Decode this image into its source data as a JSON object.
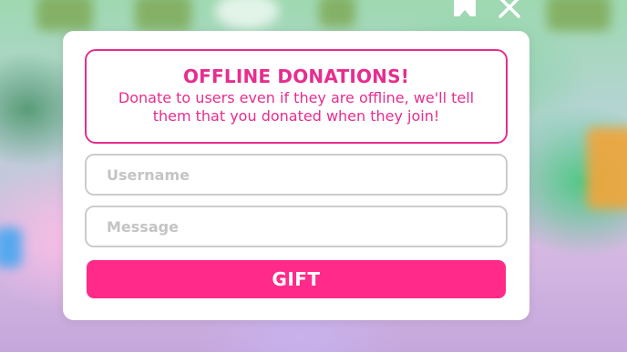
{
  "modal": {
    "title": "OFFLINE DONATIONS!",
    "description": "Donate to users even if they are offline, we'll tell them that you donated when they join!",
    "username_placeholder": "Username",
    "message_placeholder": "Message",
    "gift_label": "GIFT"
  },
  "hud": {
    "icons": [
      "tag-icon",
      "close-icon"
    ]
  },
  "colors": {
    "accent": "#ff2a89",
    "title": "#e62e8e",
    "field_border": "#cccccc",
    "placeholder": "#c4c4c4"
  }
}
